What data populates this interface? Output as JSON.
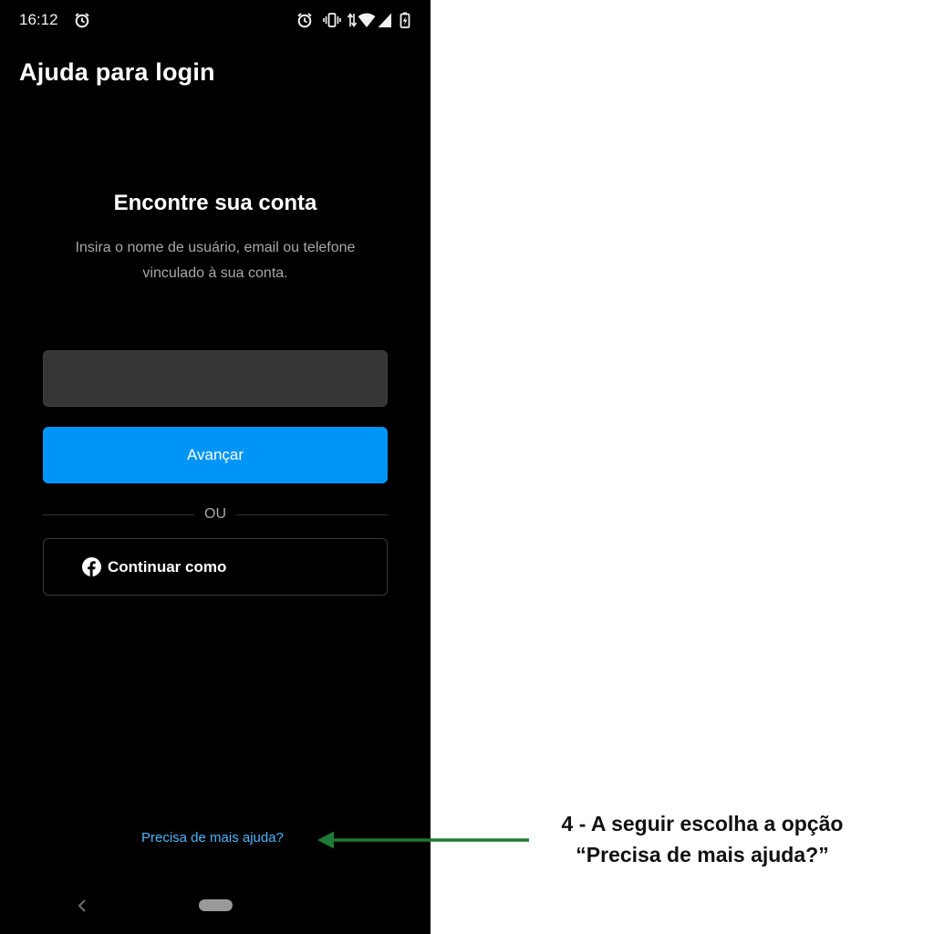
{
  "status_bar": {
    "time": "16:12",
    "icons": [
      "alarm-icon",
      "vibrate-icon",
      "data-arrows-icon",
      "wifi-icon",
      "signal-icon",
      "battery-charging-icon"
    ]
  },
  "header": {
    "title": "Ajuda para login"
  },
  "main": {
    "heading": "Encontre sua conta",
    "instructions": "Insira o nome de usuário, email ou telefone vinculado à sua conta.",
    "search_input": {
      "value": "",
      "placeholder": ""
    },
    "next_button_label": "Avançar",
    "divider_text": "OU",
    "facebook_button_label": "Continuar como",
    "help_link_label": "Precisa de mais ajuda?"
  },
  "nav_bar": {
    "icons": [
      "back-chevron-icon",
      "home-pill"
    ]
  },
  "annotation": {
    "line1": "4 - A seguir escolha a opção",
    "line2": "“Precisa de mais ajuda?”",
    "arrow_color": "#1e7a34"
  },
  "colors": {
    "background": "#000000",
    "primary_button": "#0095f6",
    "link": "#4cb5f9",
    "input_background": "#363636"
  }
}
